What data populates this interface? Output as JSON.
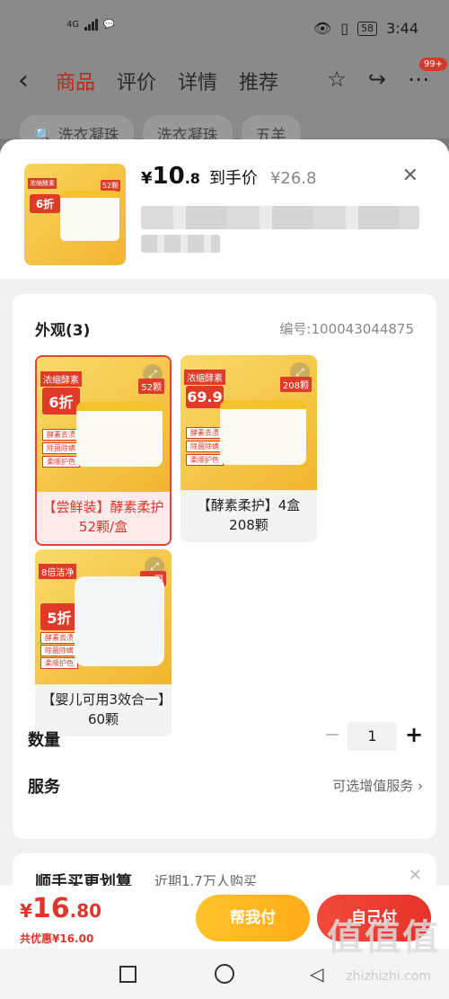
{
  "status": {
    "left_text": "4G",
    "time": "3:44",
    "battery": "58"
  },
  "header": {
    "tabs": [
      "商品",
      "评价",
      "详情",
      "推荐"
    ],
    "active_tab": 0,
    "badge": "99+",
    "chips": [
      "洗衣凝珠",
      "洗衣凝珠",
      "五羊"
    ]
  },
  "product": {
    "thumb_badge": "52颗",
    "thumb_discount": "6折",
    "price_symbol": "¥",
    "price_int": "10",
    "price_dec": ".8",
    "price_label": "到手价",
    "price_original": "¥26.8"
  },
  "variants": {
    "title": "外观(3)",
    "code": "编号:100043044875",
    "options": [
      {
        "caption": "【尝鲜装】酵素柔护52颗/盒",
        "discount": "6折",
        "count": "52颗",
        "ribbon": "浓缩酵素",
        "selected": true
      },
      {
        "caption": "【酵素柔护】4盒208颗",
        "discount": "69.9",
        "count": "208颗",
        "ribbon": "浓缩酵素",
        "selected": false
      },
      {
        "caption": "【婴儿可用3效合一】60颗",
        "discount": "5折",
        "count": "60颗",
        "ribbon": "8倍洁净",
        "selected": false
      }
    ],
    "pills": [
      "酵素去渍",
      "除菌除螨",
      "柔顺护色"
    ]
  },
  "quantity": {
    "label": "数量",
    "value": "1"
  },
  "service": {
    "label": "服务",
    "text": "可选增值服务 ›"
  },
  "recommend": {
    "title": "顺手买更划算",
    "subtitle": "近期1.7万人购买"
  },
  "bottom": {
    "symbol": "¥",
    "total_int": "16",
    "total_dec": ".80",
    "savings": "共优惠¥16.00",
    "help_pay": "帮我付",
    "self_pay": "自己付"
  },
  "watermark": {
    "text": "值值值",
    "url": "zhizhizhi.com"
  }
}
